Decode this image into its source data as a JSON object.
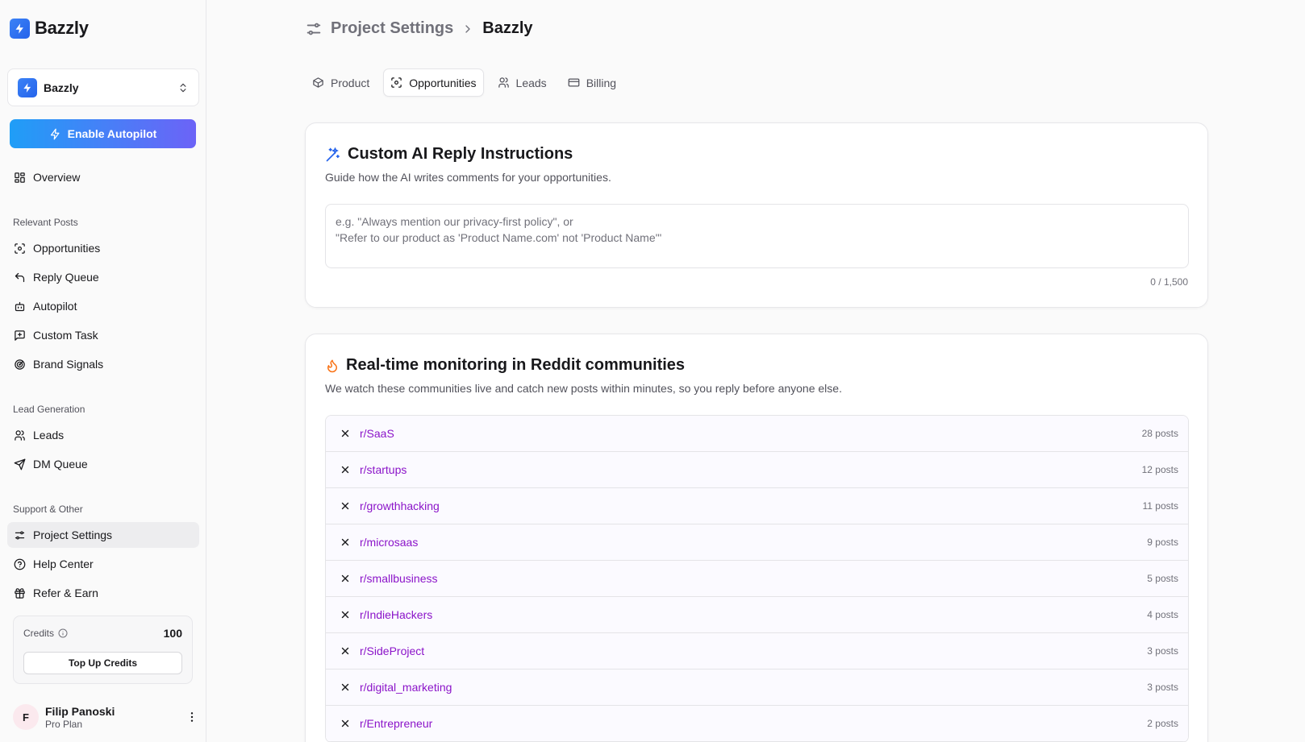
{
  "brand": {
    "name": "Bazzly",
    "accent": "#2563eb"
  },
  "project": {
    "name": "Bazzly"
  },
  "autopilot_button": "Enable Autopilot",
  "nav": {
    "overview": "Overview",
    "section_relevant": "Relevant Posts",
    "opportunities": "Opportunities",
    "reply_queue": "Reply Queue",
    "autopilot": "Autopilot",
    "custom_task": "Custom Task",
    "brand_signals": "Brand Signals",
    "section_leads": "Lead Generation",
    "leads": "Leads",
    "dm_queue": "DM Queue",
    "section_support": "Support & Other",
    "project_settings": "Project Settings",
    "help_center": "Help Center",
    "refer_earn": "Refer & Earn"
  },
  "credits": {
    "label": "Credits",
    "value": "100",
    "topup": "Top Up Credits"
  },
  "user": {
    "initial": "F",
    "name": "Filip Panoski",
    "plan": "Pro Plan"
  },
  "breadcrumb": {
    "parent": "Project Settings",
    "current": "Bazzly"
  },
  "tabs": {
    "product": "Product",
    "opportunities": "Opportunities",
    "leads": "Leads",
    "billing": "Billing"
  },
  "reply_card": {
    "title": "Custom AI Reply Instructions",
    "description": "Guide how the AI writes comments for your opportunities.",
    "placeholder": "e.g. \"Always mention our privacy-first policy\", or\n\"Refer to our product as 'Product Name.com' not 'Product Name'\"",
    "counter": "0 / 1,500"
  },
  "monitor_card": {
    "title": "Real-time monitoring in Reddit communities",
    "description": "We watch these communities live and catch new posts within minutes, so you reply before anyone else.",
    "subreddits": [
      {
        "name": "r/SaaS",
        "count": "28 posts"
      },
      {
        "name": "r/startups",
        "count": "12 posts"
      },
      {
        "name": "r/growthhacking",
        "count": "11 posts"
      },
      {
        "name": "r/microsaas",
        "count": "9 posts"
      },
      {
        "name": "r/smallbusiness",
        "count": "5 posts"
      },
      {
        "name": "r/IndieHackers",
        "count": "4 posts"
      },
      {
        "name": "r/SideProject",
        "count": "3 posts"
      },
      {
        "name": "r/digital_marketing",
        "count": "3 posts"
      },
      {
        "name": "r/Entrepreneur",
        "count": "2 posts"
      }
    ]
  }
}
